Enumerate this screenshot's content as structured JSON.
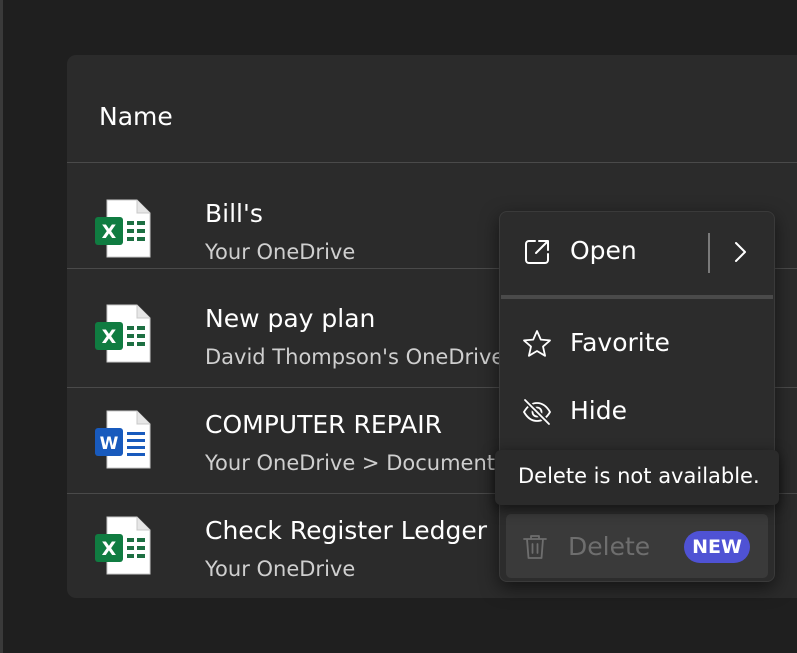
{
  "header": {
    "column_name": "Name"
  },
  "files": [
    {
      "title": "Bill's",
      "location": "Your OneDrive",
      "type": "excel",
      "icon": "excel-file-icon",
      "letter": "X"
    },
    {
      "title": "New pay plan",
      "location": "David Thompson's OneDrive",
      "type": "excel",
      "icon": "excel-file-icon",
      "letter": "X"
    },
    {
      "title": "COMPUTER REPAIR",
      "location": "Your OneDrive > Documents",
      "type": "word",
      "icon": "word-file-icon",
      "letter": "W"
    },
    {
      "title": "Check Register Ledger",
      "location": "Your OneDrive",
      "type": "excel",
      "icon": "excel-file-icon",
      "letter": "X"
    }
  ],
  "context_menu": {
    "open_label": "Open",
    "favorite_label": "Favorite",
    "hide_label": "Hide",
    "delete_label": "Delete",
    "delete_badge": "NEW",
    "icons": [
      "open-external-icon",
      "chevron-right-icon",
      "star-icon",
      "eye-off-icon",
      "trash-icon"
    ]
  },
  "tooltip": {
    "text": "Delete is not available."
  },
  "colors": {
    "background": "#1f1f1f",
    "panel": "#2b2b2b",
    "excel_green": "#107c41",
    "word_blue": "#185abd",
    "badge": "#4f52d4"
  }
}
